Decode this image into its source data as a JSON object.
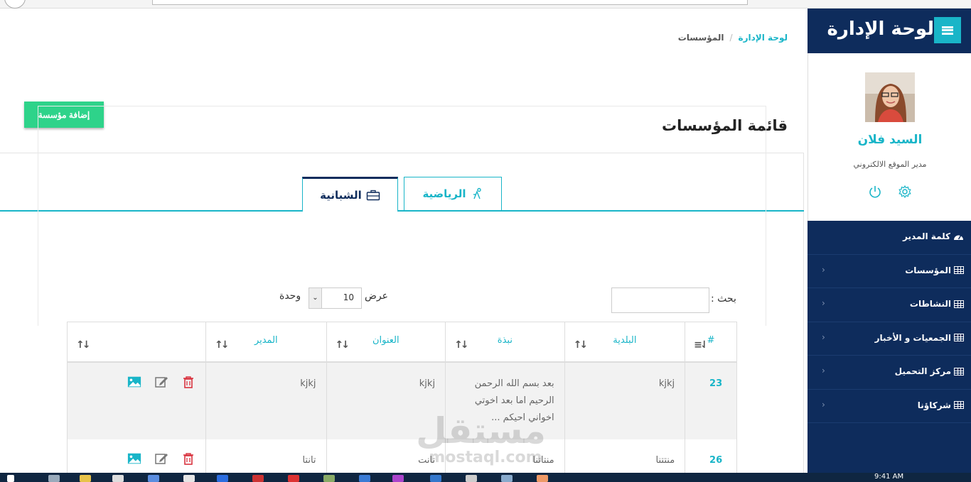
{
  "sidebar": {
    "title": "لوحة الإدارة",
    "profile": {
      "name": "السيد فلان",
      "role": "مدير الموقع الالكتروني"
    },
    "menu": [
      {
        "label": "كلمة المدير",
        "icon": "dashboard-icon"
      },
      {
        "label": "المؤسسات",
        "icon": "table-icon"
      },
      {
        "label": "النشاطات",
        "icon": "table-icon"
      },
      {
        "label": "الجمعيات و الأخبار",
        "icon": "table-icon"
      },
      {
        "label": "مركز التحميل",
        "icon": "table-icon"
      },
      {
        "label": "شركاؤنا",
        "icon": "table-icon"
      }
    ]
  },
  "breadcrumb": {
    "home": "لوحة الإدارة",
    "separator": "/",
    "current": "المؤسسات"
  },
  "page": {
    "title": "قائمة المؤسسات",
    "add_button": "إضافة مؤسسة"
  },
  "tabs": [
    {
      "label": "الشبانية",
      "icon": "briefcase-icon",
      "active": true
    },
    {
      "label": "الرياضية",
      "icon": "sports-icon",
      "active": false
    }
  ],
  "table_controls": {
    "search_label": "بحث :",
    "length_show": "عرض",
    "length_value": "10",
    "length_unit": "وحدة"
  },
  "table": {
    "headers": [
      "#",
      "البلدية",
      "نبذة",
      "العنوان",
      "المدير",
      ""
    ],
    "rows": [
      {
        "id": "23",
        "municipality": "kjkj",
        "summary": "بعد بسم الله الرحمن الرحيم اما بعد اخوتي اخواني احيكم ...",
        "address": "kjkj",
        "manager": "kjkj"
      },
      {
        "id": "26",
        "municipality": "منتتنا",
        "summary": "منتاتنا",
        "address": "تانت",
        "manager": "تانتا"
      }
    ]
  },
  "watermark": {
    "arabic": "مستقل",
    "latin": "mostaql.com"
  },
  "taskbar": {
    "clock": "9:41 AM"
  },
  "colors": {
    "sidebar_bg": "#0e2c5c",
    "accent": "#19b5c8",
    "add_button": "#2ed38a",
    "delete": "#d9333f"
  }
}
